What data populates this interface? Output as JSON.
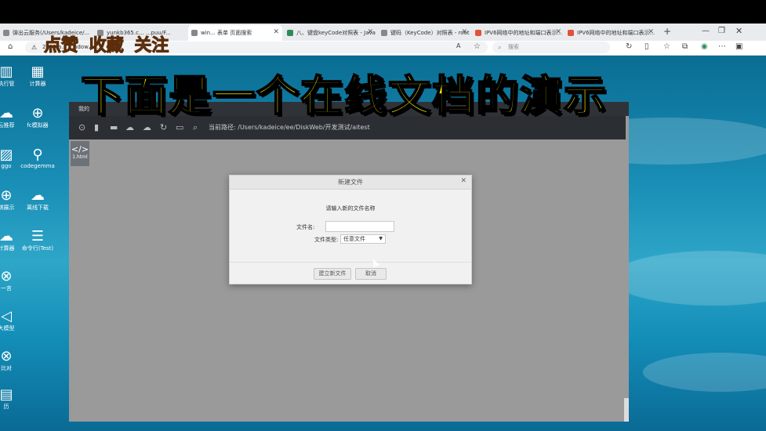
{
  "browser": {
    "tabs": [
      {
        "label": "弹出云服务(/Users/kadeice/..."
      },
      {
        "label": "yunkb365.c...  ...puu/F..."
      },
      {
        "label": "win... 表单 页面搜索"
      },
      {
        "label": "八、键盘keyCode对照表 - Java"
      },
      {
        "label": "键码（KeyCode）对照表 - root"
      },
      {
        "label": "IPV6网络中的地址和端口表示..."
      },
      {
        "label": "IPV6网络中的地址和端口表示..."
      }
    ],
    "url_text": "2012.a... ...ndow... ...l",
    "search_placeholder": "搜索"
  },
  "stickers": {
    "a": "点赞",
    "b": "收藏",
    "c": "关注"
  },
  "banner_text": "下面是一个在线文档的演示",
  "desktop_icons": [
    {
      "label": "执行管",
      "icon": "terminal-icon"
    },
    {
      "label": "计算器",
      "icon": "calculator-icon"
    },
    {
      "label": "云推荐",
      "icon": "cloud-icon"
    },
    {
      "label": "fc模拟器",
      "icon": "gamepad-icon"
    },
    {
      "label": "ggo",
      "icon": "image-icon"
    },
    {
      "label": "codegemma",
      "icon": "bicycle-icon"
    },
    {
      "label": "棋展示",
      "icon": "gamepad-icon"
    },
    {
      "label": "离线下载",
      "icon": "cloud-icon"
    },
    {
      "label": "计算器",
      "icon": "cloud-icon"
    },
    {
      "label": "命令行(Test)",
      "icon": "list-icon"
    },
    {
      "label": "一言",
      "icon": "binoculars-icon"
    },
    {
      "label": "大模型",
      "icon": "send-icon"
    },
    {
      "label": "比对",
      "icon": "binoculars-icon"
    },
    {
      "label": "历",
      "icon": "calendar-icon"
    }
  ],
  "app": {
    "title": "我的",
    "current_path_label": "当前路径:",
    "current_path": "/Users/kadeice/ee/DiskWeb/开发测试/aitest",
    "file_tab_label": "1.html"
  },
  "dialog": {
    "title": "新建文件",
    "prompt": "请输入新的文件名称",
    "name_label": "文件名:",
    "name_value": "",
    "type_label": "文件类型:",
    "type_value": "任意文件",
    "create_button": "建立新文件",
    "cancel_button": "取消"
  },
  "colors": {
    "banner": "#ffef00",
    "toolbar": "#2b2f33",
    "desktop": "#1a8fb7"
  }
}
